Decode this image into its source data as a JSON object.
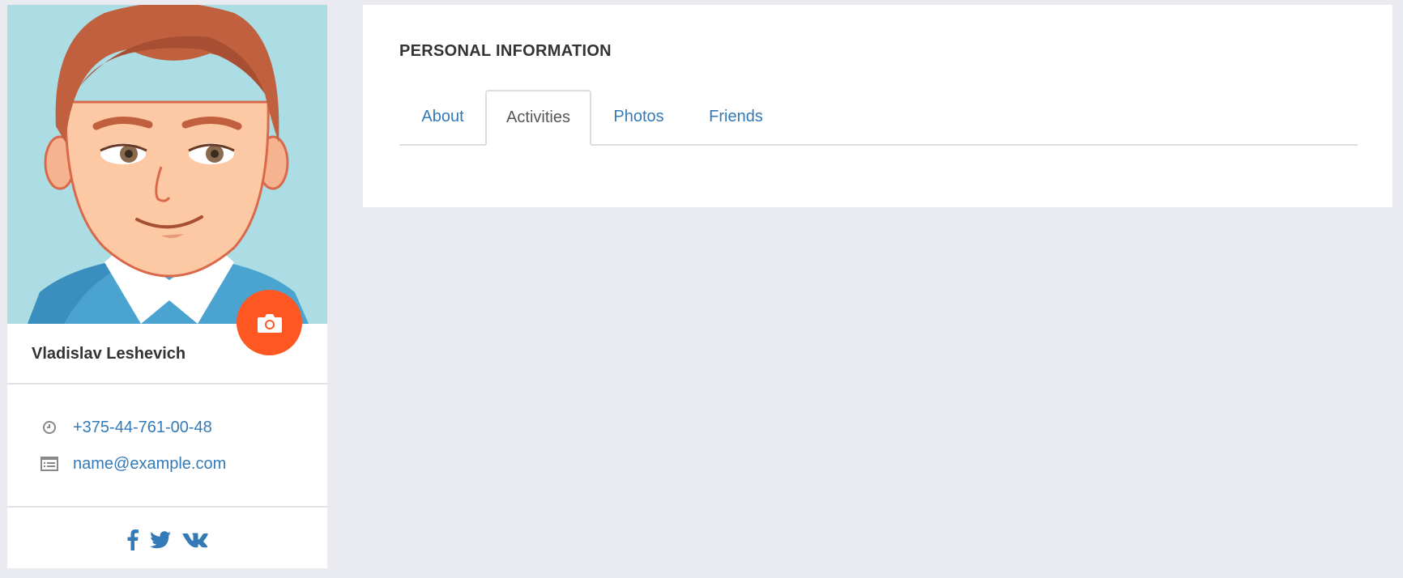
{
  "profile": {
    "name": "Vladislav Leshevich",
    "phone": "+375-44-761-00-48",
    "email": "name@example.com",
    "avatar_icon": "cartoon-avatar-illustration",
    "camera_icon": "camera-icon",
    "accent_color": "#ff5722",
    "link_color": "#337ab7",
    "socials": [
      {
        "name": "facebook",
        "glyph": "f"
      },
      {
        "name": "twitter",
        "glyph": "twitter-bird"
      },
      {
        "name": "vk",
        "glyph": "vk"
      }
    ]
  },
  "panel": {
    "title": "PERSONAL INFORMATION",
    "tabs": [
      {
        "label": "About",
        "active": false
      },
      {
        "label": "Activities",
        "active": true
      },
      {
        "label": "Photos",
        "active": false
      },
      {
        "label": "Friends",
        "active": false
      }
    ]
  },
  "colors": {
    "page_background": "#e9ebf0",
    "avatar_background": "#acdde4"
  }
}
